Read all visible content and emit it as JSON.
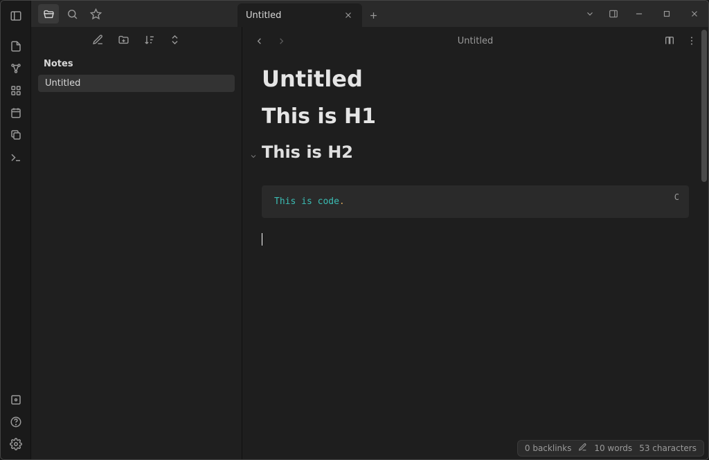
{
  "tab": {
    "title": "Untitled"
  },
  "sidebar": {
    "section_title": "Notes",
    "files": [
      {
        "name": "Untitled",
        "selected": true
      }
    ]
  },
  "editor": {
    "breadcrumb_title": "Untitled",
    "doc_title": "Untitled",
    "h1": "This is H1",
    "h2": "This is H2",
    "code_lang": "C",
    "code_text": "This is code",
    "code_dot": "."
  },
  "status": {
    "backlinks": "0 backlinks",
    "words": "10 words",
    "chars": "53 characters"
  }
}
